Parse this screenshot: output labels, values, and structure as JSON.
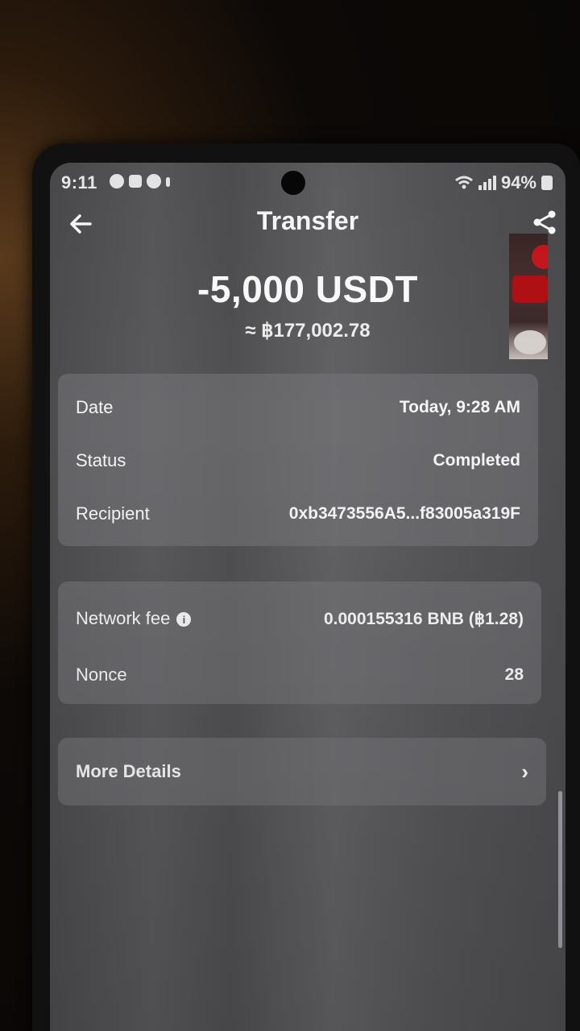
{
  "status_bar": {
    "time": "9:11",
    "battery": "94%"
  },
  "header": {
    "title": "Transfer"
  },
  "amount": {
    "value": "-5,000 USDT",
    "fiat": "≈ ฿177,002.78"
  },
  "details": [
    {
      "label": "Date",
      "value": "Today, 9:28 AM"
    },
    {
      "label": "Status",
      "value": "Completed"
    },
    {
      "label": "Recipient",
      "value": "0xb3473556A5...f83005a319F"
    }
  ],
  "fees": [
    {
      "label": "Network fee",
      "value": "0.000155316 BNB (฿1.28)"
    },
    {
      "label": "Nonce",
      "value": "28"
    }
  ],
  "more": {
    "label": "More Details"
  },
  "icons": {
    "back": "arrow-left-icon",
    "share": "share-icon",
    "info": "info-icon",
    "chevron": "chevron-right-icon"
  },
  "colors": {
    "text": "#ffffff",
    "card": "#6e6e72",
    "background": "#555558"
  }
}
